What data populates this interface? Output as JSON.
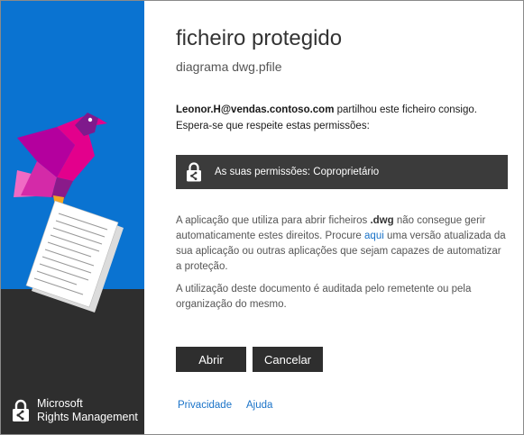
{
  "brand": {
    "line1": "Microsoft",
    "line2": "Rights Management"
  },
  "dialog": {
    "title": "ficheiro protegido",
    "filename": "diagrama dwg.pfile"
  },
  "shared": {
    "sender": "Leonor.H@vendas.contoso.com",
    "message": " partilhou este ficheiro consigo. Espera-se que respeite estas permissões:"
  },
  "permissions": {
    "label": "As suas permissões: Coproprietário"
  },
  "app_message": {
    "part1": "A aplicação que utiliza para abrir ficheiros ",
    "extension": ".dwg",
    "part2": " não consegue gerir automaticamente estes direitos. Procure ",
    "link": "aqui",
    "part3": " uma versão atualizada da sua aplicação ou outras aplicações que sejam capazes de automatizar a proteção."
  },
  "audit_message": "A utilização deste documento é auditada pelo remetente ou pela organização do mesmo.",
  "buttons": {
    "open": "Abrir",
    "cancel": "Cancelar"
  },
  "footer": {
    "privacy": "Privacidade",
    "help": "Ajuda"
  },
  "colors": {
    "panel_blue": "#0a73d1",
    "panel_dark": "#2e2e2e",
    "bird_magenta": "#b4009e",
    "bird_pink": "#e3008c",
    "link_blue": "#1a73c8"
  }
}
